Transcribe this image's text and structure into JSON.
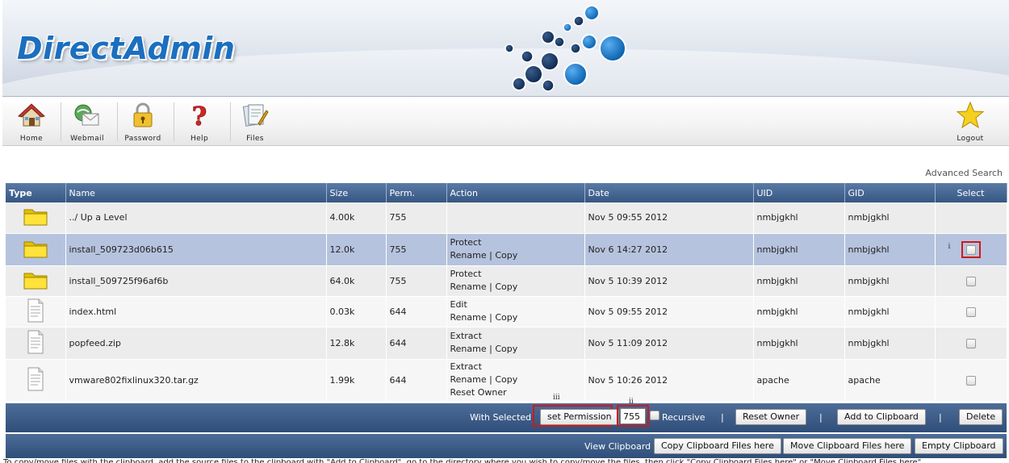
{
  "header": {
    "logo_text": "DirectAdmin"
  },
  "toolbar": {
    "items": [
      {
        "label": "Home",
        "icon": "home-icon"
      },
      {
        "label": "Webmail",
        "icon": "webmail-icon"
      },
      {
        "label": "Password",
        "icon": "lock-icon"
      },
      {
        "label": "Help",
        "icon": "help-icon"
      },
      {
        "label": "Files",
        "icon": "files-icon"
      },
      {
        "label": "Logout",
        "icon": "star-icon"
      }
    ]
  },
  "advanced_search": "Advanced Search",
  "table": {
    "columns": [
      "Type",
      "Name",
      "Size",
      "Perm.",
      "Action",
      "Date",
      "UID",
      "GID",
      "Select"
    ],
    "rows": [
      {
        "type": "folder",
        "name": "../ Up a Level",
        "size": "4.00k",
        "perm": "755",
        "actions": [],
        "date": "Nov 5 09:55 2012",
        "uid": "nmbjgkhl",
        "gid": "nmbjgkhl",
        "selectable": false
      },
      {
        "type": "folder",
        "name": "install_509723d06b615",
        "size": "12.0k",
        "perm": "755",
        "actions": [
          [
            "Protect"
          ],
          [
            "Rename",
            "Copy"
          ]
        ],
        "date": "Nov 6 14:27 2012",
        "uid": "nmbjgkhl",
        "gid": "nmbjgkhl",
        "selectable": true,
        "highlighted": true,
        "marker": "i"
      },
      {
        "type": "folder",
        "name": "install_509725f96af6b",
        "size": "64.0k",
        "perm": "755",
        "actions": [
          [
            "Protect"
          ],
          [
            "Rename",
            "Copy"
          ]
        ],
        "date": "Nov 5 10:39 2012",
        "uid": "nmbjgkhl",
        "gid": "nmbjgkhl",
        "selectable": true
      },
      {
        "type": "file",
        "name": "index.html",
        "size": "0.03k",
        "perm": "644",
        "actions": [
          [
            "Edit"
          ],
          [
            "Rename",
            "Copy"
          ]
        ],
        "date": "Nov 5 09:55 2012",
        "uid": "nmbjgkhl",
        "gid": "nmbjgkhl",
        "selectable": true
      },
      {
        "type": "file",
        "name": "popfeed.zip",
        "size": "12.8k",
        "perm": "644",
        "actions": [
          [
            "Extract"
          ],
          [
            "Rename",
            "Copy"
          ]
        ],
        "date": "Nov 5 11:09 2012",
        "uid": "nmbjgkhl",
        "gid": "nmbjgkhl",
        "selectable": true
      },
      {
        "type": "file",
        "name": "vmware802fixlinux320.tar.gz",
        "size": "1.99k",
        "perm": "644",
        "actions": [
          [
            "Extract"
          ],
          [
            "Rename",
            "Copy"
          ],
          [
            "Reset Owner"
          ]
        ],
        "date": "Nov 5 10:26 2012",
        "uid": "apache",
        "gid": "apache",
        "selectable": true
      }
    ]
  },
  "selected_bar": {
    "label": "With Selected",
    "set_permission": "set Permission",
    "permission_value": "755",
    "recursive_label": "Recursive",
    "reset_owner": "Reset Owner",
    "add_clipboard": "Add to Clipboard",
    "delete": "Delete",
    "marker_ii": "ii",
    "marker_iii": "iii",
    "separator": "|"
  },
  "clipboard_bar": {
    "label": "View Clipboard",
    "copy_here": "Copy Clipboard Files here",
    "move_here": "Move Clipboard Files here",
    "empty": "Empty Clipboard"
  },
  "footer": "To copy/move files with the clipboard, add the source files to the clipboard with \"Add to Clipboard\", go to the directory where you wish to copy/move the files, then click \"Copy Clipboard Files here\" or \"Move Clipboard Files here\"."
}
